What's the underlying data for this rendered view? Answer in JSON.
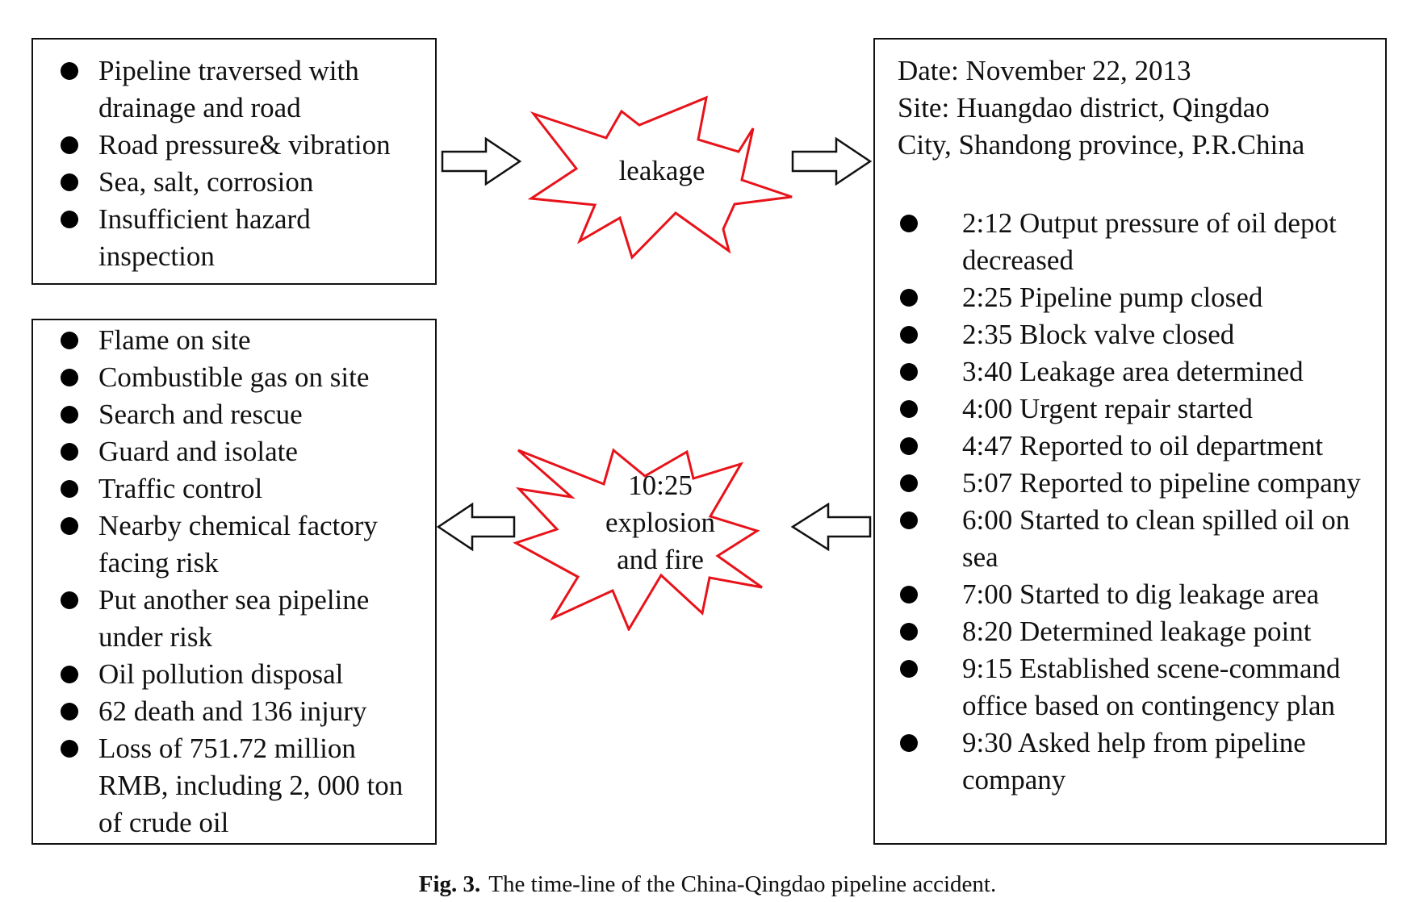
{
  "causes": {
    "items": [
      "Pipeline traversed with drainage and road",
      "Road pressure& vibration",
      "Sea, salt, corrosion",
      "Insufficient hazard inspection"
    ]
  },
  "events": {
    "leakage_label": "leakage",
    "explosion_label": "10:25 explosion and fire",
    "burst_stroke_color": "#e8131a"
  },
  "timeline": {
    "date_line": "Date: November 22, 2013",
    "site_line_1": "Site: Huangdao district, Qingdao",
    "site_line_2": "City, Shandong province, P.R.China",
    "items": [
      "2:12 Output pressure of oil depot decreased",
      "2:25 Pipeline pump closed",
      "2:35 Block valve closed",
      "3:40 Leakage area determined",
      "4:00 Urgent repair started",
      "4:47 Reported to oil department",
      "5:07 Reported to pipeline company",
      "6:00 Started to  clean spilled oil on sea",
      "7:00 Started to  dig leakage area",
      "8:20 Determined leakage point",
      "9:15 Established scene-command office based on contingency plan",
      "9:30 Asked help from pipeline company"
    ]
  },
  "consequences": {
    "items": [
      "Flame on site",
      "Combustible gas on site",
      "Search and rescue",
      "Guard and isolate",
      "Traffic control",
      "Nearby chemical factory facing risk",
      "Put another sea pipeline under risk",
      "Oil pollution disposal",
      "62 death and 136 injury",
      "Loss of 751.72 million RMB, including 2, 000 ton of crude oil"
    ]
  },
  "caption": {
    "label": "Fig. 3.",
    "text": "The time-line of the China-Qingdao pipeline accident."
  }
}
